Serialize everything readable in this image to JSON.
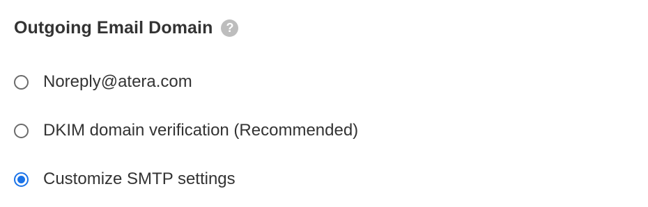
{
  "section": {
    "title": "Outgoing Email Domain",
    "help_icon": "help-circle-icon",
    "help_glyph": "?"
  },
  "options": [
    {
      "label": "Noreply@atera.com",
      "selected": false
    },
    {
      "label": "DKIM domain verification (Recommended)",
      "selected": false
    },
    {
      "label": "Customize SMTP settings",
      "selected": true
    }
  ],
  "colors": {
    "selected_accent": "#1a73e8",
    "help_icon_bg": "#bdbdbd",
    "text": "#333333"
  }
}
